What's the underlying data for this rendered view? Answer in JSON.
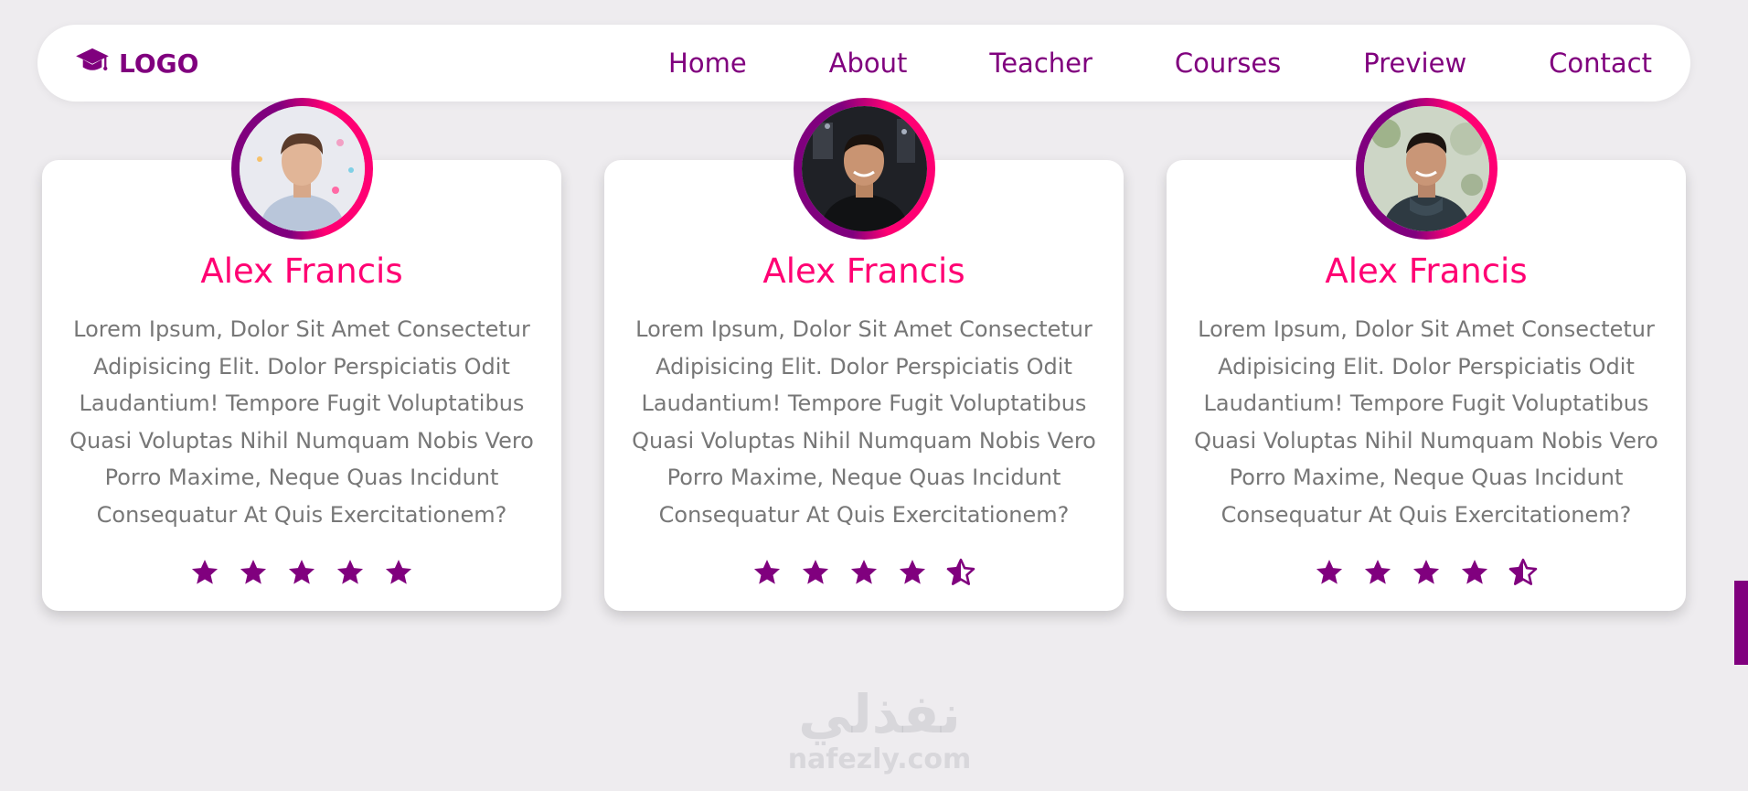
{
  "colors": {
    "brand": "#80007e",
    "accent": "#ff0073",
    "text_muted": "#777777",
    "background": "#eeecef"
  },
  "navbar": {
    "logo_icon": "graduation-cap-icon",
    "logo_text": "LOGO",
    "links": [
      {
        "label": "Home"
      },
      {
        "label": "About"
      },
      {
        "label": "Teacher"
      },
      {
        "label": "Courses"
      },
      {
        "label": "Preview"
      },
      {
        "label": "Contact"
      }
    ]
  },
  "cards": [
    {
      "name": "Alex Francis",
      "text": "Lorem Ipsum, Dolor Sit Amet Consectetur Adipisicing Elit. Dolor Perspiciatis Odit Laudantium! Tempore Fugit Voluptatibus Quasi Voluptas Nihil Numquam Nobis Vero Porro Maxime, Neque Quas Incidunt Consequatur At Quis Exercitationem?",
      "rating": 5,
      "avatar": "person-photo-light-background"
    },
    {
      "name": "Alex Francis",
      "text": "Lorem Ipsum, Dolor Sit Amet Consectetur Adipisicing Elit. Dolor Perspiciatis Odit Laudantium! Tempore Fugit Voluptatibus Quasi Voluptas Nihil Numquam Nobis Vero Porro Maxime, Neque Quas Incidunt Consequatur At Quis Exercitationem?",
      "rating": 4.5,
      "avatar": "person-photo-dark-background"
    },
    {
      "name": "Alex Francis",
      "text": "Lorem Ipsum, Dolor Sit Amet Consectetur Adipisicing Elit. Dolor Perspiciatis Odit Laudantium! Tempore Fugit Voluptatibus Quasi Voluptas Nihil Numquam Nobis Vero Porro Maxime, Neque Quas Incidunt Consequatur At Quis Exercitationem?",
      "rating": 4.5,
      "avatar": "person-photo-outdoor-background"
    }
  ],
  "watermark": {
    "arabic": "نفذلي",
    "latin": "nafezly.com"
  }
}
